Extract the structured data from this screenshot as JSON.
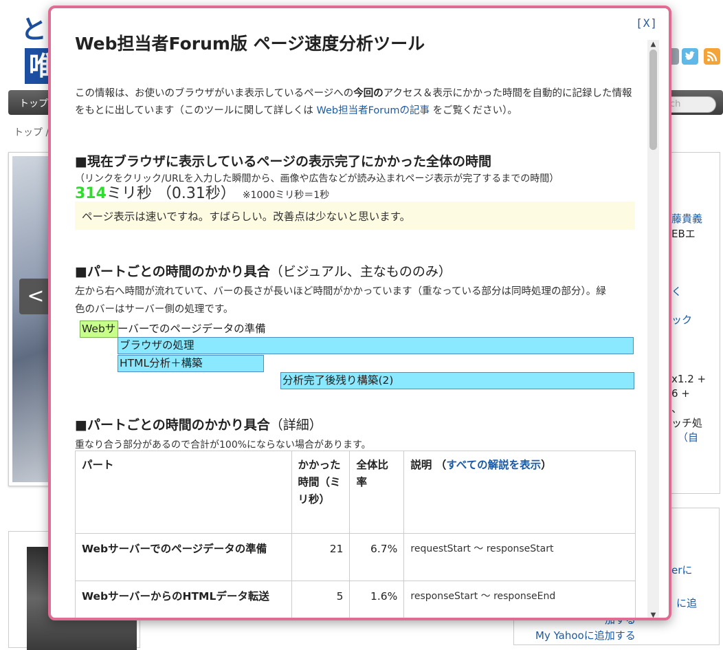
{
  "background": {
    "logo_top": "と",
    "logo_bottom": "唯",
    "nav_item": "トップ",
    "search_placeholder": "ch",
    "breadcrumb": "トップ /",
    "hero_prev": "<",
    "right_texts": [
      "藤貴義",
      "EBエ",
      "く",
      "ック",
      "x1.2 +",
      "6 +",
      "、",
      "ッチ処",
      "（自",
      "erに",
      "に追",
      "加する"
    ],
    "yahoo_link": "My Yahooに追加する"
  },
  "modal": {
    "close_label": "[X]",
    "title": "Web担当者Forum版 ページ速度分析ツール",
    "intro": {
      "part1": "この情報は、お使いのブラウザがいま表示しているページへの",
      "bold": "今回の",
      "part2": "アクセス＆表示にかかった時間を自動的に記録した情報をもとに出しています（このツールに関して詳しくは ",
      "link": "Web担当者Forumの記事",
      "part3": " をご覧ください）。"
    },
    "total": {
      "heading": "■現在ブラウザに表示しているページの表示完了にかかった全体の時間",
      "note": "（リンクをクリック/URLを入力した瞬間から、画像や広告などが読み込まれページ表示が完了するまでの時間）",
      "ms_value": "314",
      "unit_text": "ミリ秒 （0.31秒）",
      "conversion": "※1000ミリ秒＝1秒",
      "verdict": "ページ表示は速いですね。すばらしい。改善点は少ないと思います。"
    },
    "visual": {
      "heading": "■パートごとの時間のかかり具合",
      "heading_sub": "（ビジュアル、主なもののみ）",
      "desc_line1": "左から右へ時間が流れていて、バーの長さが長いほど時間がかかっています（重なっている部分は同時処理の部分）。緑",
      "desc_line2": "色のバーはサーバー側の処理です。",
      "bars": [
        {
          "label_in": "Webサ",
          "label_out": "ーバーでのページデータの準備"
        },
        {
          "label_in": "ブラウザの処理"
        },
        {
          "label_in": "HTML分析＋構築"
        },
        {
          "label_in": "分析完了後残り構築(2)"
        }
      ]
    },
    "detail": {
      "heading": "■パートごとの時間のかかり具合",
      "heading_sub": "（詳細）",
      "note": "重なり合う部分があるので合計が100%にならない場合があります。",
      "columns": {
        "part": "パート",
        "time": "かかった時間（ミリ秒）",
        "ratio": "全体比率",
        "desc": "説明",
        "desc_link": "すべての解説を表示"
      },
      "rows": [
        {
          "part": "Webサーバーでのページデータの準備",
          "time": "21",
          "ratio": "6.7%",
          "desc": "requestStart 〜 responseStart"
        },
        {
          "part": "WebサーバーからのHTMLデータ転送",
          "time": "5",
          "ratio": "1.6%",
          "desc": "responseStart 〜 responseEnd"
        }
      ]
    }
  },
  "colors": {
    "modal_border": "#e06b93",
    "ms_value": "#2fdc2f",
    "server_bar": "#c8ff8a",
    "browser_bar": "#8ae8ff",
    "link": "#1a5aa6"
  }
}
